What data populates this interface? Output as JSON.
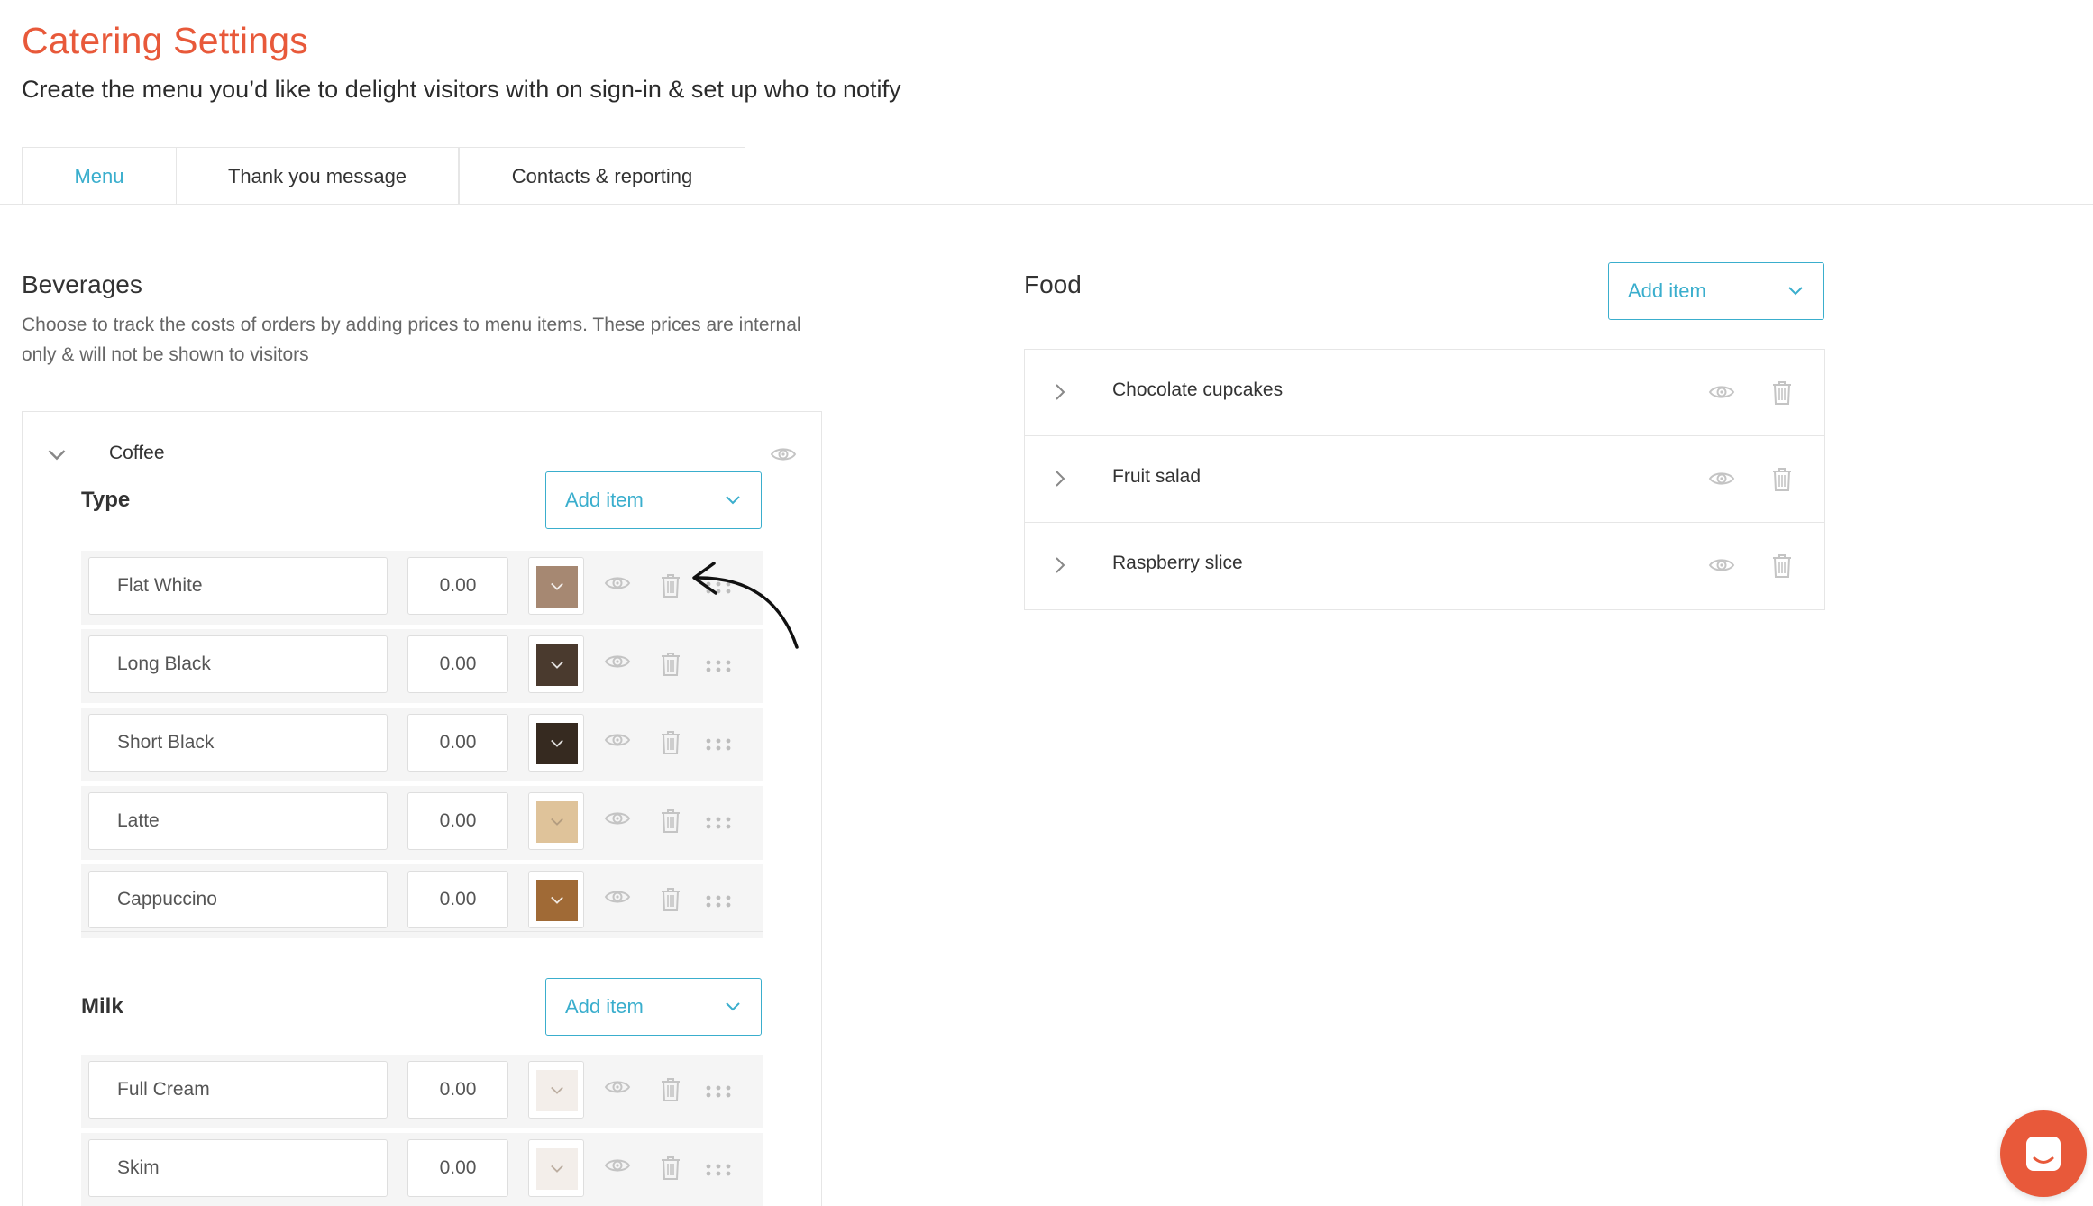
{
  "header": {
    "title": "Catering Settings",
    "subtitle": "Create the menu you’d like to delight visitors with on sign-in & set up who to notify"
  },
  "tabs": [
    {
      "label": "Menu",
      "active": true
    },
    {
      "label": "Thank you message",
      "active": false
    },
    {
      "label": "Contacts & reporting",
      "active": false
    }
  ],
  "beverages": {
    "title": "Beverages",
    "description": "Choose to track the costs of orders by adding prices to menu items. These prices are internal only & will not be shown to visitors",
    "category": "Coffee",
    "groups": [
      {
        "label": "Type",
        "add_label": "Add item",
        "items": [
          {
            "name": "Flat White",
            "price": "0.00",
            "color": "#a68872"
          },
          {
            "name": "Long Black",
            "price": "0.00",
            "color": "#4a3a2e"
          },
          {
            "name": "Short Black",
            "price": "0.00",
            "color": "#362a20"
          },
          {
            "name": "Latte",
            "price": "0.00",
            "color": "#dfc39a"
          },
          {
            "name": "Cappuccino",
            "price": "0.00",
            "color": "#a06a36"
          }
        ]
      },
      {
        "label": "Milk",
        "add_label": "Add item",
        "items": [
          {
            "name": "Full Cream",
            "price": "0.00",
            "color": "#f3eeea"
          },
          {
            "name": "Skim",
            "price": "0.00",
            "color": "#f3eeea"
          }
        ]
      }
    ]
  },
  "food": {
    "title": "Food",
    "add_label": "Add item",
    "items": [
      {
        "name": "Chocolate cupcakes"
      },
      {
        "name": "Fruit salad"
      },
      {
        "name": "Raspberry slice"
      }
    ]
  },
  "colors": {
    "accent": "#3aaecd",
    "brand": "#e8593a"
  }
}
